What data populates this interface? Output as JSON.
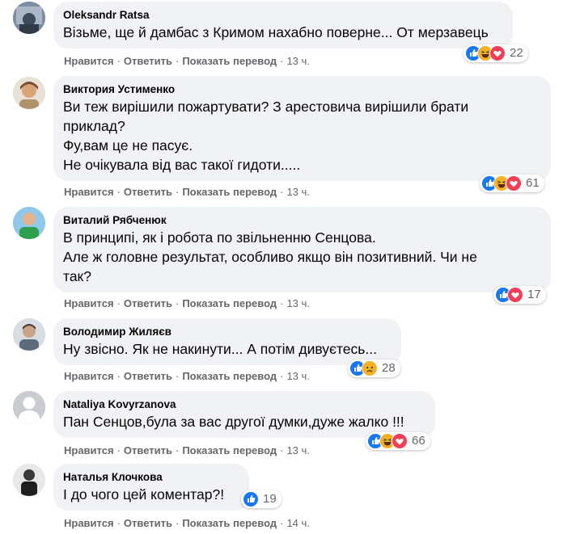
{
  "labels": {
    "like": "Нравится",
    "reply": "Ответить",
    "translate": "Показать перевод",
    "sep": "·"
  },
  "comments": [
    {
      "author": "Oleksandr Ratsa",
      "lines": [
        "Візьме, ще й дамбас з Кримом нахабно поверне... От мерзавець"
      ],
      "time": "13 ч.",
      "reactions": [
        "like",
        "haha",
        "love"
      ],
      "reaction_count": "22",
      "avatar": "photo-avatar"
    },
    {
      "author": "Виктория Устименко",
      "lines": [
        "Ви теж вирішили пожартувати? З арестовича вирішили брати",
        "приклад?",
        "Фу,вам це не пасує.",
        "Не очікувала від вас такої гидоти....."
      ],
      "time": "13 ч.",
      "reactions": [
        "like",
        "haha",
        "love"
      ],
      "reaction_count": "61",
      "avatar": "photo-avatar"
    },
    {
      "author": "Виталий Рябченюк",
      "lines": [
        "В принципі, як і робота по звільненню Сенцова.",
        "Але ж головне результат, особливо якщо він позитивний. Чи не",
        "так?"
      ],
      "time": "13 ч.",
      "reactions": [
        "like",
        "love"
      ],
      "reaction_count": "17",
      "avatar": "photo-avatar"
    },
    {
      "author": "Володимир Жиляєв",
      "lines": [
        "Ну звісно. Як не накинути... А потім дивуєтесь..."
      ],
      "time": "13 ч.",
      "reactions": [
        "like",
        "sad"
      ],
      "reaction_count": "28",
      "avatar": "photo-avatar"
    },
    {
      "author": "Nataliya Kovyrzanova",
      "lines": [
        "Пан Сенцов,була за вас другої думки,дуже жалко !!!"
      ],
      "time": "13 ч.",
      "reactions": [
        "like",
        "haha",
        "love"
      ],
      "reaction_count": "66",
      "avatar": "default-avatar"
    },
    {
      "author": "Наталья Клочкова",
      "lines": [
        "І до чого цей коментар?!"
      ],
      "time": "14 ч.",
      "reactions": [
        "like"
      ],
      "reaction_count": "19",
      "avatar": "photo-avatar"
    }
  ],
  "colors": {
    "like": "#1877f2",
    "love": "#f33e58",
    "haha": "#f7b125",
    "sad": "#f7b125",
    "bubble": "#f0f2f5",
    "meta": "#65676b"
  }
}
